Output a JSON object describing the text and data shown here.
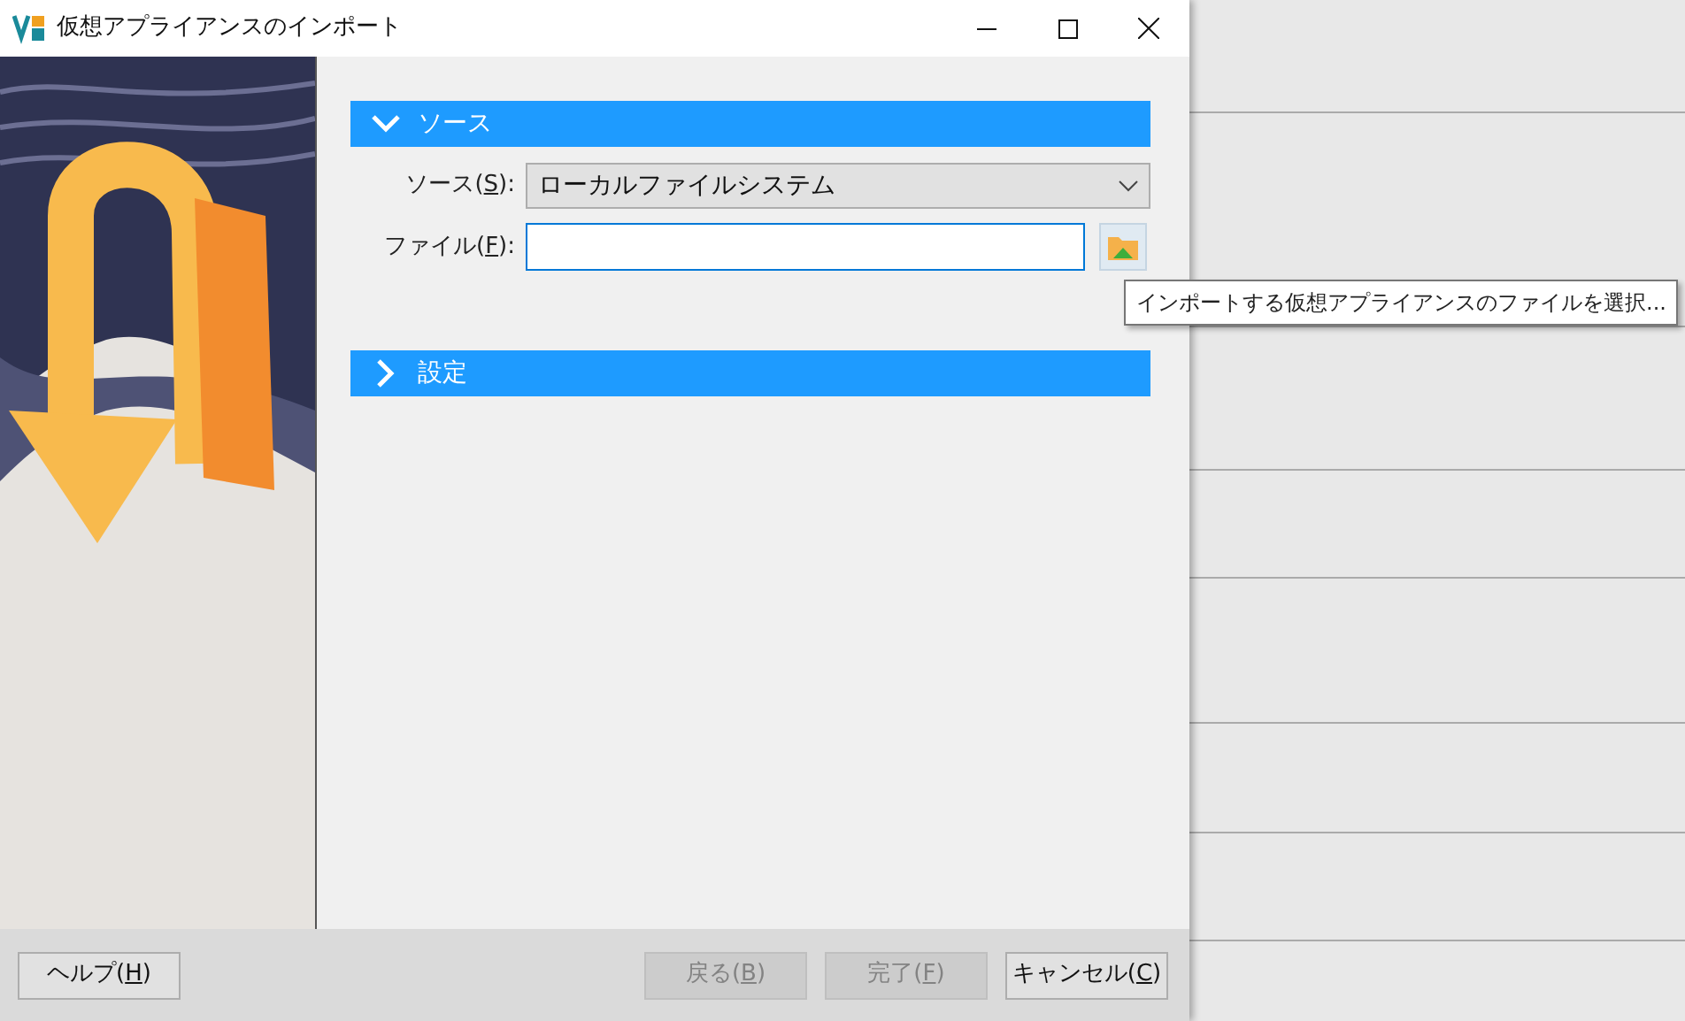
{
  "window": {
    "title": "仮想アプライアンスのインポート"
  },
  "sections": [
    {
      "title": "ソース",
      "expanded": true,
      "fields": [
        {
          "kind": "dropdown",
          "label_parts": [
            "ソース(",
            "S",
            "):"
          ],
          "value": "ローカルファイルシステム"
        },
        {
          "kind": "file",
          "label_parts": [
            "ファイル(",
            "F",
            "):"
          ]
        }
      ]
    },
    {
      "title": "設定",
      "expanded": false
    }
  ],
  "tooltip": "インポートする仮想アプライアンスのファイルを選択...",
  "left_buttons": [
    {
      "label_parts": [
        "ヘルプ(",
        "H",
        ")"
      ],
      "disabled": false
    }
  ],
  "right_buttons": [
    {
      "label_parts": [
        "戻る(",
        "B",
        ")"
      ],
      "disabled": true
    },
    {
      "label_parts": [
        "完了(",
        "F",
        ")"
      ],
      "disabled": true
    },
    {
      "label_parts": [
        "キャンセル(",
        "C",
        ")"
      ],
      "disabled": false
    }
  ]
}
